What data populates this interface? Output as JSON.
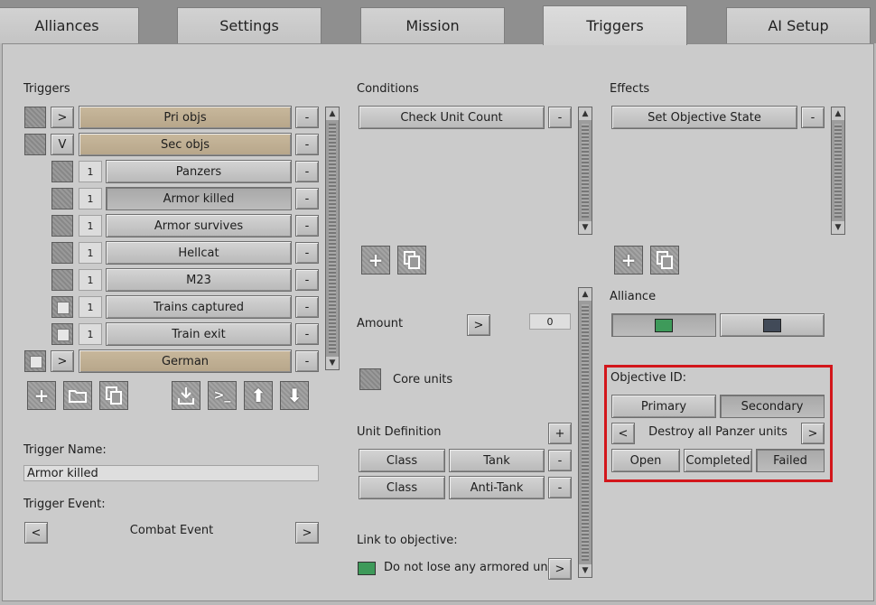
{
  "tabs": [
    "Alliances",
    "Settings",
    "Mission",
    "Triggers",
    "AI Setup"
  ],
  "triggers": {
    "heading": "Triggers",
    "rows": [
      {
        "expand": ">",
        "label": "Pri objs",
        "minus": "-"
      },
      {
        "expand": "V",
        "label": "Sec objs",
        "minus": "-"
      },
      {
        "index": "1",
        "label": "Panzers",
        "minus": "-"
      },
      {
        "index": "1",
        "label": "Armor killed",
        "minus": "-"
      },
      {
        "index": "1",
        "label": "Armor survives",
        "minus": "-"
      },
      {
        "index": "1",
        "label": "Hellcat",
        "minus": "-"
      },
      {
        "index": "1",
        "label": "M23",
        "minus": "-"
      },
      {
        "index": "1",
        "label": "Trains captured",
        "minus": "-"
      },
      {
        "index": "1",
        "label": "Train exit",
        "minus": "-"
      },
      {
        "expand": ">",
        "label": "German",
        "minus": "-"
      }
    ],
    "toolbar": [
      "add-icon",
      "folder-icon",
      "copy-icon",
      "import-icon",
      "console-icon",
      "arrow-up-icon",
      "arrow-down-icon"
    ]
  },
  "trigger_name": {
    "label": "Trigger Name:",
    "value": "Armor killed"
  },
  "trigger_event": {
    "label": "Trigger Event:",
    "prev": "<",
    "value": "Combat Event",
    "next": ">"
  },
  "conditions": {
    "heading": "Conditions",
    "items": [
      {
        "label": "Check Unit Count",
        "minus": "-"
      }
    ],
    "amount_label": "Amount",
    "amount_btn": ">",
    "amount_value": "0",
    "core_units": "Core units",
    "unit_def_label": "Unit Definition",
    "unit_def_add": "+",
    "unit_defs": [
      {
        "key": "Class",
        "value": "Tank",
        "minus": "-"
      },
      {
        "key": "Class",
        "value": "Anti-Tank",
        "minus": "-"
      }
    ],
    "link_label": "Link to objective:",
    "link_value": "Do not lose any armored units",
    "link_btn": ">"
  },
  "effects": {
    "heading": "Effects",
    "items": [
      {
        "label": "Set Objective State",
        "minus": "-"
      }
    ],
    "alliance_label": "Alliance",
    "alliance_colors": [
      "#3e9a5a",
      "#414a58"
    ],
    "objective_label": "Objective ID:",
    "primary": "Primary",
    "secondary": "Secondary",
    "prev": "<",
    "objective_value": "Destroy all Panzer units",
    "next": ">",
    "states": [
      "Open",
      "Completed",
      "Failed"
    ]
  },
  "colors": {
    "highlight": "#d3161b",
    "link_swatch": "#3e9a5a"
  }
}
